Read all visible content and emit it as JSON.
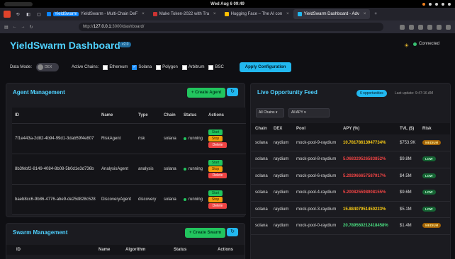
{
  "os": {
    "clock": "Wed Aug 6  09:49"
  },
  "tabs": [
    {
      "label": "YieldSwarm - Multi-Chain DeF",
      "brand": "YieldSwarm",
      "color": "#0a84ff",
      "active": false
    },
    {
      "label": "Make Token-2022 with Tra",
      "color": "#cc3333",
      "active": false
    },
    {
      "label": "Hugging Face – The AI con",
      "color": "#ffbf00",
      "active": false
    },
    {
      "label": "YieldSwarm Dashboard - Adv",
      "color": "#22b8ef",
      "active": true
    }
  ],
  "nav": {
    "url_host": "127.0.0.1",
    "url_rest": ":3000/dashboard/",
    "url_prefix": "http://"
  },
  "header": {
    "title": "YieldSwarm Dashboard",
    "version_badge": "v2.0",
    "connection": "Connected"
  },
  "controls": {
    "data_mode_label": "Data Mode:",
    "toggle_text": "DEX",
    "chains_label": "Active Chains:",
    "chains": [
      {
        "name": "Ethereum",
        "checked": false
      },
      {
        "name": "Solana",
        "checked": true
      },
      {
        "name": "Polygon",
        "checked": false
      },
      {
        "name": "Arbitrum",
        "checked": false
      },
      {
        "name": "BSC",
        "checked": false
      }
    ],
    "apply_label": "Apply Configuration"
  },
  "agents": {
    "title": "Agent Management",
    "create_label": "+ Create Agent",
    "refresh_icon": "↻",
    "columns": [
      "ID",
      "Name",
      "Type",
      "Chain",
      "Status",
      "Actions"
    ],
    "rows": [
      {
        "id": "7f1e443a-2d82-4b94-99d1-3dab59f4e807",
        "name": "RiskAgent",
        "type": "risk",
        "chain": "solana",
        "status": "running"
      },
      {
        "id": "8b3febf2-8149-4084-8b08-5b0d1e3d736b",
        "name": "AnalysisAgent",
        "type": "analysis",
        "chain": "solana",
        "status": "running"
      },
      {
        "id": "baeb8cc6-9b86-4776-abe9-de25d828c528",
        "name": "DiscoveryAgent",
        "type": "discovery",
        "chain": "solana",
        "status": "running"
      }
    ],
    "actions": {
      "start": "Start",
      "stop": "Stop",
      "delete": "Delete"
    }
  },
  "swarm": {
    "title": "Swarm Management",
    "create_label": "+ Create Swarm",
    "refresh_icon": "↻",
    "columns": [
      "ID",
      "Name",
      "Algorithm",
      "Status",
      "Actions"
    ]
  },
  "opportunities": {
    "title": "Live Opportunity Feed",
    "count_badge": "6 opportunities",
    "last_update": "Last update: 9:47:16 AM",
    "filter_chain": "All Chains ▾",
    "filter_apy": "All APY ▾",
    "columns": [
      "Chain",
      "DEX",
      "Pool",
      "APY (%)",
      "TVL ($)",
      "Risk"
    ],
    "rows": [
      {
        "chain": "solana",
        "dex": "raydium",
        "pool": "mock-pool-9-raydium",
        "apy": "10.78178613947734%",
        "apy_class": "apy-y",
        "tvl": "$753.9K",
        "risk": "MEDIUM",
        "risk_class": "medium"
      },
      {
        "chain": "solana",
        "dex": "raydium",
        "pool": "mock-pool-8-raydium",
        "apy": "5.068329526583852%",
        "apy_class": "apy-r",
        "tvl": "$9.8M",
        "risk": "LOW",
        "risk_class": "low"
      },
      {
        "chain": "solana",
        "dex": "raydium",
        "pool": "mock-pool-6-raydium",
        "apy": "5.292966657587917%",
        "apy_class": "apy-r",
        "tvl": "$4.5M",
        "risk": "LOW",
        "risk_class": "low"
      },
      {
        "chain": "solana",
        "dex": "raydium",
        "pool": "mock-pool-4-raydium",
        "apy": "5.200825598908155%",
        "apy_class": "apy-r",
        "tvl": "$9.6M",
        "risk": "LOW",
        "risk_class": "low"
      },
      {
        "chain": "solana",
        "dex": "raydium",
        "pool": "mock-pool-3-raydium",
        "apy": "15.88407951450233%",
        "apy_class": "apy-y",
        "tvl": "$5.1M",
        "risk": "LOW",
        "risk_class": "low"
      },
      {
        "chain": "solana",
        "dex": "raydium",
        "pool": "mock-pool-0-raydium",
        "apy": "20.789560212418458%",
        "apy_class": "apy-g",
        "tvl": "$1.4M",
        "risk": "MEDIUM",
        "risk_class": "medium"
      }
    ]
  }
}
